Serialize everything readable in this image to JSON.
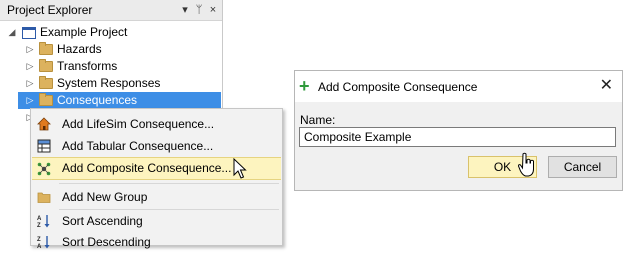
{
  "explorer": {
    "title": "Project Explorer",
    "header_buttons": [
      "▾",
      "ᛘ",
      "×"
    ],
    "tree": [
      {
        "label": "Example Project",
        "arrow": "◢",
        "icon": "project-icon",
        "indent": 0
      },
      {
        "label": "Hazards",
        "arrow": "▷",
        "icon": "folder-icon",
        "indent": 1
      },
      {
        "label": "Transforms",
        "arrow": "▷",
        "icon": "folder-icon",
        "indent": 1
      },
      {
        "label": "System Responses",
        "arrow": "▷",
        "icon": "folder-icon",
        "indent": 1
      },
      {
        "label": "Consequences",
        "arrow": "▷",
        "icon": "folder-icon",
        "indent": 1,
        "selected": true
      }
    ]
  },
  "context_menu": {
    "items": [
      {
        "label": "Add LifeSim Consequence...",
        "icon": "house-icon"
      },
      {
        "label": "Add Tabular Consequence...",
        "icon": "table-icon"
      },
      {
        "label": "Add Composite Consequence...",
        "icon": "composite-icon",
        "highlighted": true
      },
      {
        "label": "Add New Group",
        "icon": "folder-icon"
      },
      {
        "label": "Sort Ascending",
        "icon": "sort-ascending-icon"
      },
      {
        "label": "Sort Descending",
        "icon": "sort-descending-icon"
      }
    ]
  },
  "dialog": {
    "title": "Add Composite Consequence",
    "close_glyph": "✕",
    "name_label": "Name:",
    "name_value": "Composite Example",
    "ok_label": "OK",
    "cancel_label": "Cancel"
  },
  "colors": {
    "selection": "#3d8ee6",
    "menu_highlight": "#fdf4bf",
    "folder": "#dcb25e",
    "plus": "#2f9a3b"
  }
}
